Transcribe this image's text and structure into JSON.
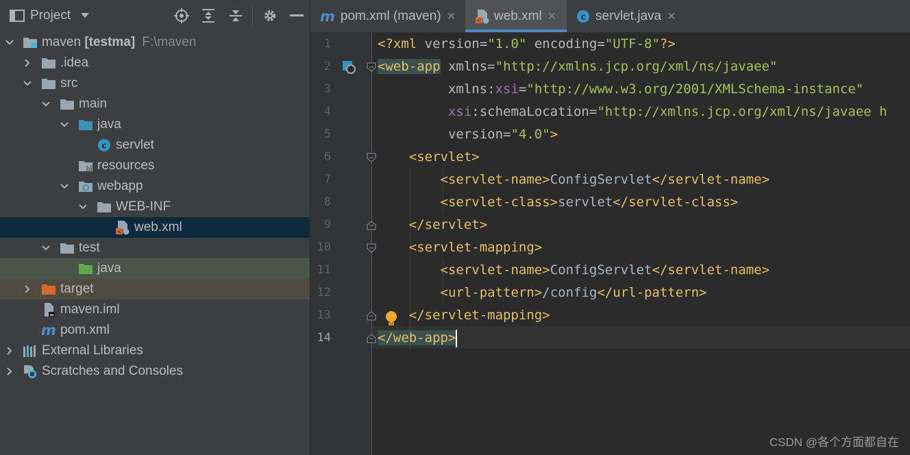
{
  "project_panel": {
    "title": "Project",
    "tree": [
      {
        "label": "maven",
        "bold": "[testma]",
        "hint": "F:\\maven",
        "icon": "module-folder-icon",
        "arrow": "down"
      },
      {
        "label": ".idea",
        "icon": "folder-icon",
        "arrow": "right"
      },
      {
        "label": "src",
        "icon": "folder-icon",
        "arrow": "down"
      },
      {
        "label": "main",
        "icon": "folder-icon",
        "arrow": "down"
      },
      {
        "label": "java",
        "icon": "source-folder-icon",
        "arrow": "down"
      },
      {
        "label": "servlet",
        "icon": "java-class-icon",
        "arrow": ""
      },
      {
        "label": "resources",
        "icon": "resources-folder-icon",
        "arrow": ""
      },
      {
        "label": "webapp",
        "icon": "web-folder-icon",
        "arrow": "down"
      },
      {
        "label": "WEB-INF",
        "icon": "folder-icon",
        "arrow": "down"
      },
      {
        "label": "web.xml",
        "icon": "web-xml-icon",
        "arrow": ""
      },
      {
        "label": "test",
        "icon": "folder-icon",
        "arrow": "down"
      },
      {
        "label": "java",
        "icon": "test-folder-icon",
        "arrow": ""
      },
      {
        "label": "target",
        "icon": "excluded-folder-icon",
        "arrow": "right"
      },
      {
        "label": "maven.iml",
        "icon": "iml-file-icon",
        "arrow": ""
      },
      {
        "label": "pom.xml",
        "icon": "maven-icon",
        "arrow": ""
      },
      {
        "label": "External Libraries",
        "icon": "libraries-icon",
        "arrow": "right"
      },
      {
        "label": "Scratches and Consoles",
        "icon": "scratches-icon",
        "arrow": "right"
      }
    ]
  },
  "tabs": [
    {
      "label": "pom.xml (maven)",
      "icon": "maven-icon"
    },
    {
      "label": "web.xml",
      "icon": "web-xml-icon"
    },
    {
      "label": "servlet.java",
      "icon": "java-class-icon"
    }
  ],
  "tab_close": "✕",
  "editor": {
    "line_numbers": [
      "1",
      "2",
      "3",
      "4",
      "5",
      "6",
      "7",
      "8",
      "9",
      "10",
      "11",
      "12",
      "13",
      "14"
    ],
    "lines": [
      "<?xml version=\"1.0\" encoding=\"UTF-8\"?>",
      "<web-app xmlns=\"http://xmlns.jcp.org/xml/ns/javaee\"",
      "         xmlns:xsi=\"http://www.w3.org/2001/XMLSchema-instance\"",
      "         xsi:schemaLocation=\"http://xmlns.jcp.org/xml/ns/javaee h",
      "         version=\"4.0\">",
      "    <servlet>",
      "        <servlet-name>ConfigServlet</servlet-name>",
      "        <servlet-class>servlet</servlet-class>",
      "    </servlet>",
      "    <servlet-mapping>",
      "        <servlet-name>ConfigServlet</servlet-name>",
      "        <url-pattern>/config</url-pattern>",
      "    </servlet-mapping>",
      "</web-app>"
    ],
    "current_line": "14"
  },
  "watermark": "CSDN @各个方面都自在",
  "colors": {
    "panel_bg": "#3c3f41",
    "editor_bg": "#2b2b2b",
    "selection": "#0d293e",
    "tag": "#e8bf6a",
    "attr_value": "#a5c25c",
    "namespace": "#9876aa",
    "active_tab_underline": "#4a88c7"
  }
}
